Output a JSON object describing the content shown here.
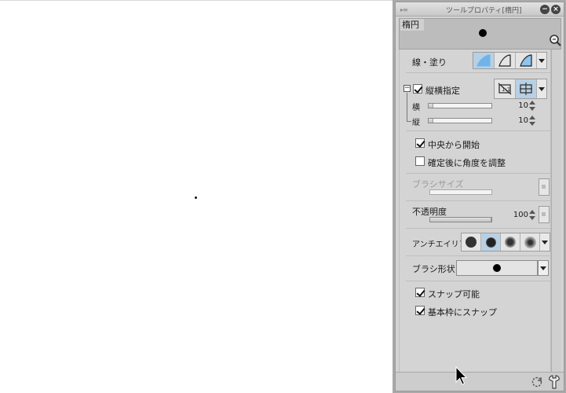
{
  "panel": {
    "title": "ツールプロパティ[楕円]",
    "preview_label": "楕円"
  },
  "line_fill": {
    "label": "線・塗り",
    "options": [
      "line",
      "fill",
      "line-and-fill"
    ],
    "selected": "fill"
  },
  "aspect": {
    "label": "縦横指定",
    "checked": true,
    "width": {
      "label": "横",
      "value": "10",
      "fraction": 0.07
    },
    "height": {
      "label": "縦",
      "value": "10",
      "fraction": 0.07
    }
  },
  "options": {
    "start_from_center": {
      "label": "中央から開始",
      "checked": true
    },
    "adjust_angle": {
      "label": "確定後に角度を調整",
      "checked": false
    }
  },
  "brush_size": {
    "label": "ブラシサイズ",
    "disabled": true
  },
  "opacity": {
    "label": "不透明度",
    "value": "100",
    "fraction": 1.0
  },
  "antialias": {
    "label": "アンチエイリアス",
    "levels": [
      "none",
      "weak",
      "medium",
      "strong"
    ],
    "selected": "weak"
  },
  "brush_shape": {
    "label": "ブラシ形状"
  },
  "snap": {
    "snappable": {
      "label": "スナップ可能",
      "checked": true
    },
    "frame_snap": {
      "label": "基本枠にスナップ",
      "checked": true
    }
  },
  "colors": {
    "accent": "#8ec4ee",
    "active_bg": "#b8d0e4",
    "panel_bg": "#d4d4d4"
  }
}
